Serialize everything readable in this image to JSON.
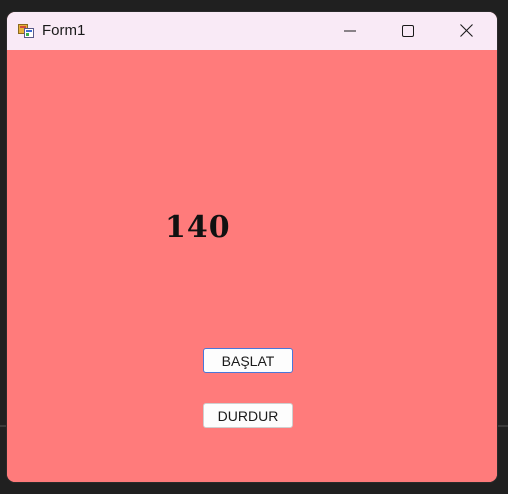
{
  "window": {
    "title": "Form1",
    "icon": "winforms-app-icon",
    "controls": {
      "minimize": "minimize-icon",
      "maximize": "maximize-icon",
      "close": "close-icon"
    }
  },
  "form": {
    "background_color": "#ff7b7b",
    "counter_value": "140",
    "start_button_label": "BAŞLAT",
    "stop_button_label": "DURDUR"
  }
}
